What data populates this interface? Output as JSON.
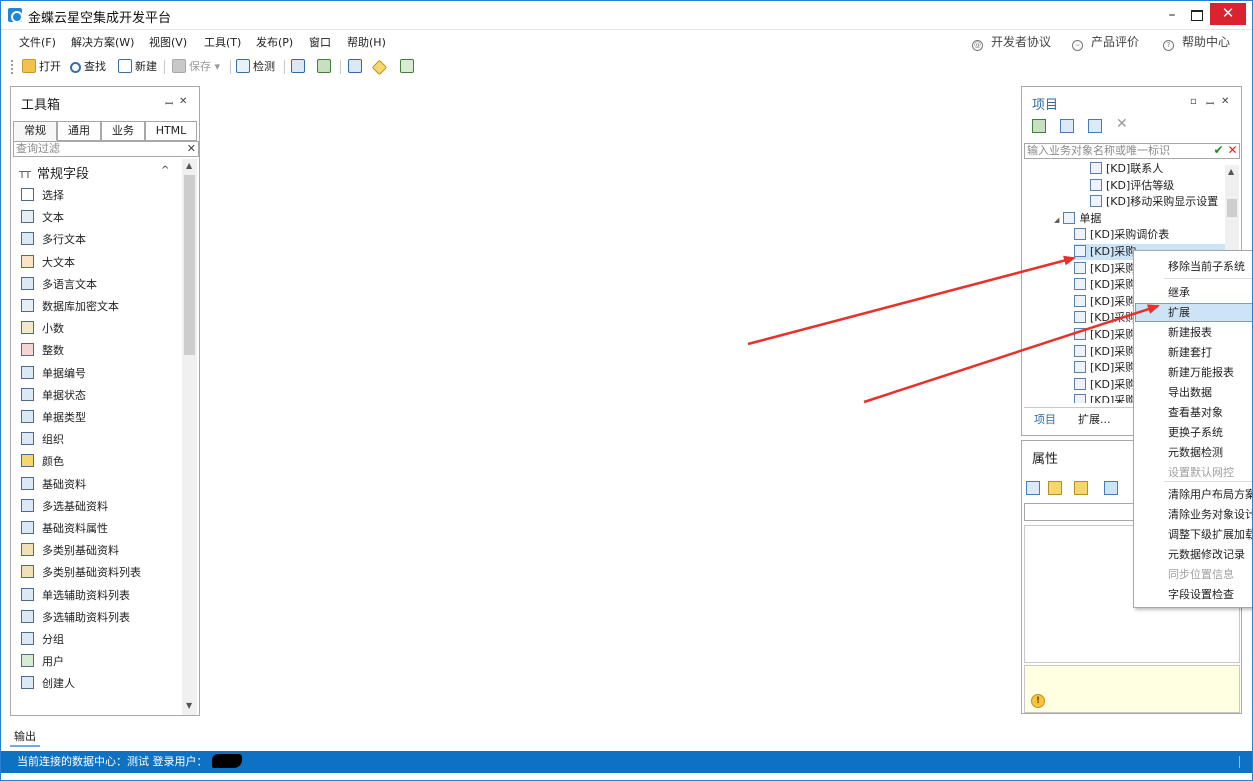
{
  "window": {
    "title": "金蝶云星空集成开发平台",
    "min": "–",
    "close": "✕"
  },
  "menu": [
    "文件(F)",
    "解决方案(W)",
    "视图(V)",
    "工具(T)",
    "发布(P)",
    "窗口",
    "帮助(H)"
  ],
  "help_links": [
    "开发者协议",
    "产品评价",
    "帮助中心"
  ],
  "toolbar": {
    "open": "打开",
    "find": "查找",
    "new": "新建",
    "save": "保存",
    "save_caret": "▾",
    "check": "检测"
  },
  "toolbox": {
    "title": "工具箱",
    "pin": "ꟷ",
    "close": "✕",
    "tabs": [
      "常规",
      "通用",
      "业务",
      "HTML"
    ],
    "filter_placeholder": "查询过滤",
    "filter_clear": "✕",
    "section_icon": "TT",
    "section": "常规字段",
    "section_caret": "^",
    "items": [
      "选择",
      "文本",
      "多行文本",
      "大文本",
      "多语言文本",
      "数据库加密文本",
      "小数",
      "整数",
      "单据编号",
      "单据状态",
      "单据类型",
      "组织",
      "颜色",
      "基础资料",
      "多选基础资料",
      "基础资料属性",
      "多类别基础资料",
      "多类别基础资料列表",
      "单选辅助资料列表",
      "多选辅助资料列表",
      "分组",
      "用户",
      "创建人"
    ]
  },
  "project": {
    "title": "项目",
    "search_placeholder": "输入业务对象名称或唯一标识",
    "ok": "✔",
    "cancel": "✕",
    "tree": [
      "[KD]联系人",
      "[KD]评估等级",
      "[KD]移动采购显示设置",
      "单据",
      "[KD]采购调价表",
      "[KD]采购",
      "[KD]采购",
      "[KD]采购",
      "[KD]采购",
      "[KD]采购",
      "[KD]采购",
      "[KD]采购",
      "[KD]采购",
      "[KD]采购",
      "[KD]采购",
      "[KD]采购"
    ],
    "tree_toggle": "◢",
    "tabs": [
      "项目",
      "扩展..."
    ]
  },
  "properties": {
    "title": "属性",
    "warn": "!"
  },
  "context_menu": [
    "移除当前子系统",
    "继承",
    "扩展",
    "新建报表",
    "新建套打",
    "新建万能报表",
    "导出数据",
    "查看基对象",
    "更换子系统",
    "元数据检测",
    "设置默认网控",
    "清除用户布局方案",
    "清除业务对象设计",
    "调整下级扩展加载",
    "元数据修改记录",
    "同步位置信息",
    "字段设置检查"
  ],
  "output": {
    "tab": "输出"
  },
  "status": {
    "text": "当前连接的数据中心：测试  登录用户："
  },
  "colors": {
    "accent": "#0e72c4",
    "annotation": "#e8312a",
    "close": "#d9232e"
  }
}
